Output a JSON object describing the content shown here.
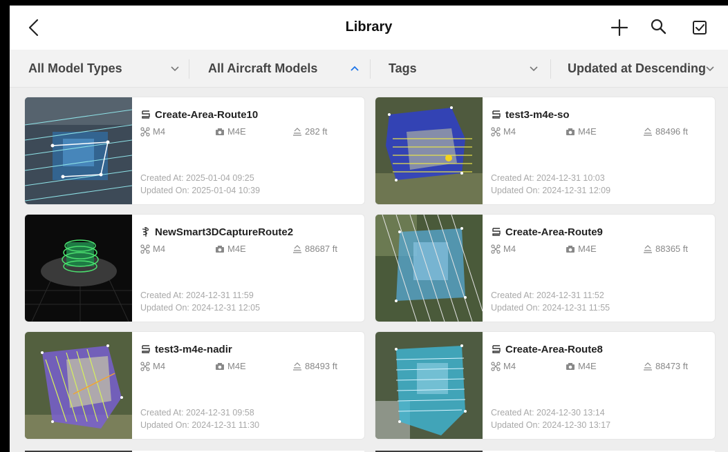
{
  "header": {
    "title": "Library"
  },
  "filters": [
    {
      "label": "All Model Types",
      "chevron": "down"
    },
    {
      "label": "All Aircraft Models",
      "chevron": "up"
    },
    {
      "label": "Tags",
      "chevron": "down"
    },
    {
      "label": "Updated at Descending",
      "chevron": "down"
    }
  ],
  "colors": {
    "accent": "#1a73e8",
    "title": "#111111",
    "meta": "#888888",
    "date": "#a8a8a8"
  },
  "routes": [
    {
      "icon": "route-icon",
      "name": "Create-Area-Route10",
      "drone": "M4",
      "camera": "M4E",
      "altitude": "282 ft",
      "created": "Created At: 2025-01-04 09:25",
      "updated": "Updated On: 2025-01-04 10:39"
    },
    {
      "icon": "route-icon",
      "name": "test3-m4e-so",
      "drone": "M4",
      "camera": "M4E",
      "altitude": "88496 ft",
      "created": "Created At: 2024-12-31 10:03",
      "updated": "Updated On: 2024-12-31 12:09"
    },
    {
      "icon": "smart-3d-icon",
      "name": "NewSmart3DCaptureRoute2",
      "drone": "M4",
      "camera": "M4E",
      "altitude": "88687 ft",
      "created": "Created At: 2024-12-31 11:59",
      "updated": "Updated On: 2024-12-31 12:05"
    },
    {
      "icon": "route-icon",
      "name": "Create-Area-Route9",
      "drone": "M4",
      "camera": "M4E",
      "altitude": "88365 ft",
      "created": "Created At: 2024-12-31 11:52",
      "updated": "Updated On: 2024-12-31 11:55"
    },
    {
      "icon": "route-icon",
      "name": "test3-m4e-nadir",
      "drone": "M4",
      "camera": "M4E",
      "altitude": "88493 ft",
      "created": "Created At: 2024-12-31 09:58",
      "updated": "Updated On: 2024-12-31 11:30"
    },
    {
      "icon": "route-icon",
      "name": "Create-Area-Route8",
      "drone": "M4",
      "camera": "M4E",
      "altitude": "88473 ft",
      "created": "Created At: 2024-12-30 13:14",
      "updated": "Updated On: 2024-12-30 13:17"
    }
  ]
}
